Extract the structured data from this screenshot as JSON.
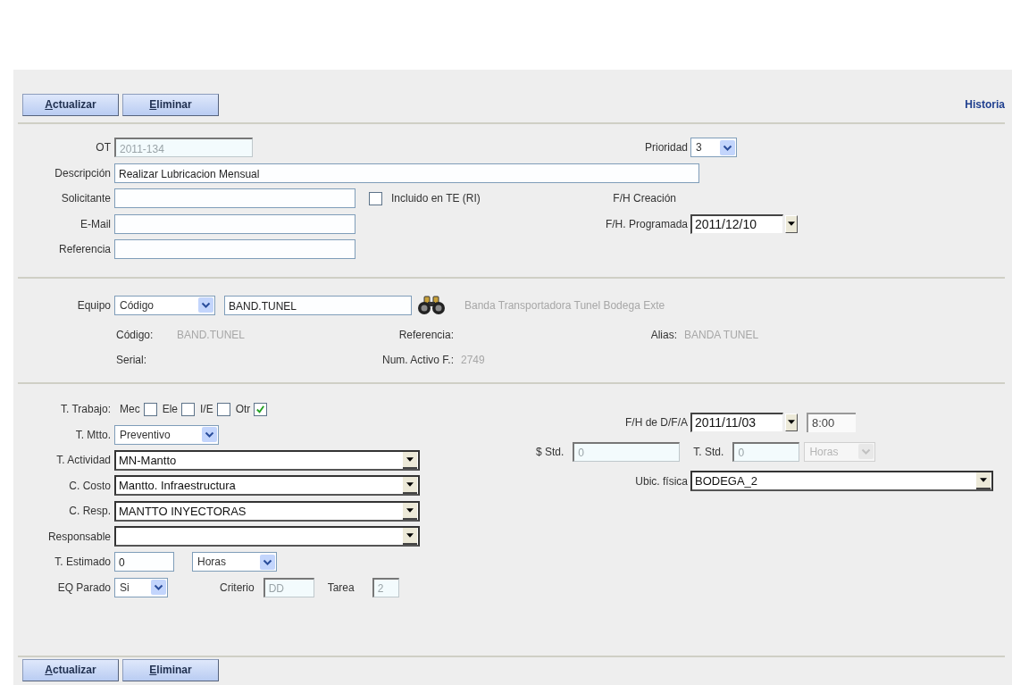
{
  "toolbar_top": {
    "buttons": [
      {
        "label": "Actualizar"
      },
      {
        "label": "Eliminar"
      }
    ],
    "link": "Historia"
  },
  "header": {
    "ot": {
      "label": "OT",
      "value": "2011-134",
      "disabled": true
    },
    "prioridad": {
      "label": "Prioridad",
      "value": "3"
    },
    "descripcion": {
      "label": "Descripción",
      "value": "Realizar Lubricacion Mensual"
    },
    "solicitante": {
      "label": "Solicitante"
    },
    "incluido": {
      "label": "Incluido en TE (RI)",
      "checked": false
    },
    "fh_creacion": {
      "label": "F/H Creación"
    },
    "email": {
      "label": "E-Mail"
    },
    "fh_programada": {
      "label": "F/H. Programada",
      "value": "2011/12/10"
    },
    "referencia": {
      "label": "Referencia"
    }
  },
  "equipo": {
    "label": "Equipo",
    "search_by": "Código",
    "code": "BAND.TUNEL",
    "description": "Banda Transportadora Tunel Bodega Exte",
    "details": [
      {
        "label": "Código:",
        "value": "BAND.TUNEL"
      },
      {
        "label": "Referencia:"
      },
      {
        "label": "Alias:",
        "value": "BANDA TUNEL"
      },
      {
        "label": "Serial:"
      },
      {
        "label": "Num. Activo F.:",
        "value": "2749"
      }
    ]
  },
  "trabajo": {
    "label": "T. Trabajo:",
    "types": [
      {
        "label": "Mec",
        "checked": false
      },
      {
        "label": "Ele",
        "checked": false
      },
      {
        "label": "I/E",
        "checked": false
      },
      {
        "label": "Otr",
        "checked": true
      }
    ]
  },
  "mtto": {
    "label": "T. Mtto.",
    "value": "Preventivo"
  },
  "combos": [
    {
      "label": "T. Actividad",
      "value": "MN-Mantto"
    },
    {
      "label": "C. Costo",
      "value": "Mantto. Infraestructura"
    },
    {
      "label": "C. Resp.",
      "value": "MANTTO INYECTORAS"
    },
    {
      "label": "Responsable"
    }
  ],
  "estimado": {
    "label": "T. Estimado",
    "value": "0",
    "unit": "Horas"
  },
  "parado": {
    "label": "EQ Parado",
    "value": "Si"
  },
  "criterio": {
    "label": "Criterio",
    "value": "DD",
    "disabled": true
  },
  "tarea": {
    "label": "Tarea",
    "value": "2",
    "disabled": true
  },
  "fh_dfa": {
    "label": "F/H de D/F/A",
    "date": "2011/11/03",
    "time": "8:00"
  },
  "std": {
    "cost_label": "$ Std.",
    "cost": "0",
    "time_label": "T. Std.",
    "time": "0",
    "unit": "Horas",
    "disabled": true
  },
  "ubicacion": {
    "label": "Ubic. física",
    "value": "BODEGA_2"
  },
  "toolbar_bottom": {
    "buttons": [
      {
        "label": "Actualizar"
      },
      {
        "label": "Eliminar"
      }
    ]
  }
}
